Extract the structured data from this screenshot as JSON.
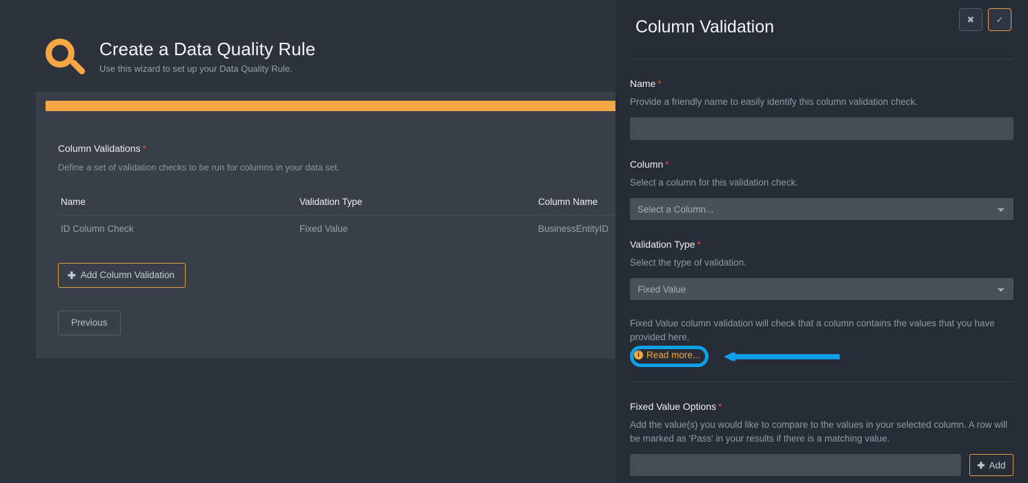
{
  "wizard": {
    "icon": "magnifier-icon",
    "title": "Create a Data Quality Rule",
    "subtitle": "Use this wizard to set up your Data Quality Rule.",
    "progress_percent": 98,
    "section": {
      "label": "Column Validations",
      "required_marker": "*",
      "description": "Define a set of validation checks to be run for columns in your data set."
    },
    "table": {
      "headers": [
        "Name",
        "Validation Type",
        "Column Name"
      ],
      "rows": [
        {
          "name": "ID Column Check",
          "validation_type": "Fixed Value",
          "column_name": "BusinessEntityID"
        }
      ]
    },
    "add_validation_button": {
      "icon": "plus-icon",
      "label": "Add Column Validation"
    },
    "previous_button": "Previous"
  },
  "panel": {
    "title": "Column Validation",
    "close_button": {
      "icon": "close-icon",
      "glyph": "✖"
    },
    "confirm_button": {
      "icon": "check-icon",
      "glyph": "✓"
    },
    "fields": {
      "name": {
        "label": "Name",
        "required_marker": "*",
        "help": "Provide a friendly name to easily identify this column validation check.",
        "value": "",
        "placeholder": ""
      },
      "column": {
        "label": "Column",
        "required_marker": "*",
        "help": "Select a column for this validation check.",
        "selected": "Select a Column...",
        "options": [
          "Select a Column..."
        ]
      },
      "validation_type": {
        "label": "Validation Type",
        "required_marker": "*",
        "help": "Select the type of validation.",
        "selected": "Fixed Value",
        "options": [
          "Fixed Value"
        ]
      },
      "fixed_value_options": {
        "label": "Fixed Value Options",
        "required_marker": "*",
        "help": "Add the value(s) you would like to compare to the values in your selected column. A row will be marked as 'Pass' in your results if there is a matching value.",
        "value": "",
        "placeholder": "",
        "add_button": {
          "icon": "plus-icon",
          "label": "Add"
        }
      }
    },
    "validation_type_description": "Fixed Value column validation will check that a column contains the values that you have provided here.",
    "read_more": {
      "icon": "info-circle-icon",
      "label": "Read more..."
    }
  },
  "annotation": {
    "highlight_color": "#0fa0e8",
    "target": "read-more-link",
    "arrow_direction": "left"
  },
  "colors": {
    "page_background": "#2e323c",
    "card_background": "#3a3e48",
    "panel_background": "#282c36",
    "accent_orange": "#f4a742",
    "required_red": "#e74c3c",
    "annotation_cyan": "#0fa0e8"
  }
}
